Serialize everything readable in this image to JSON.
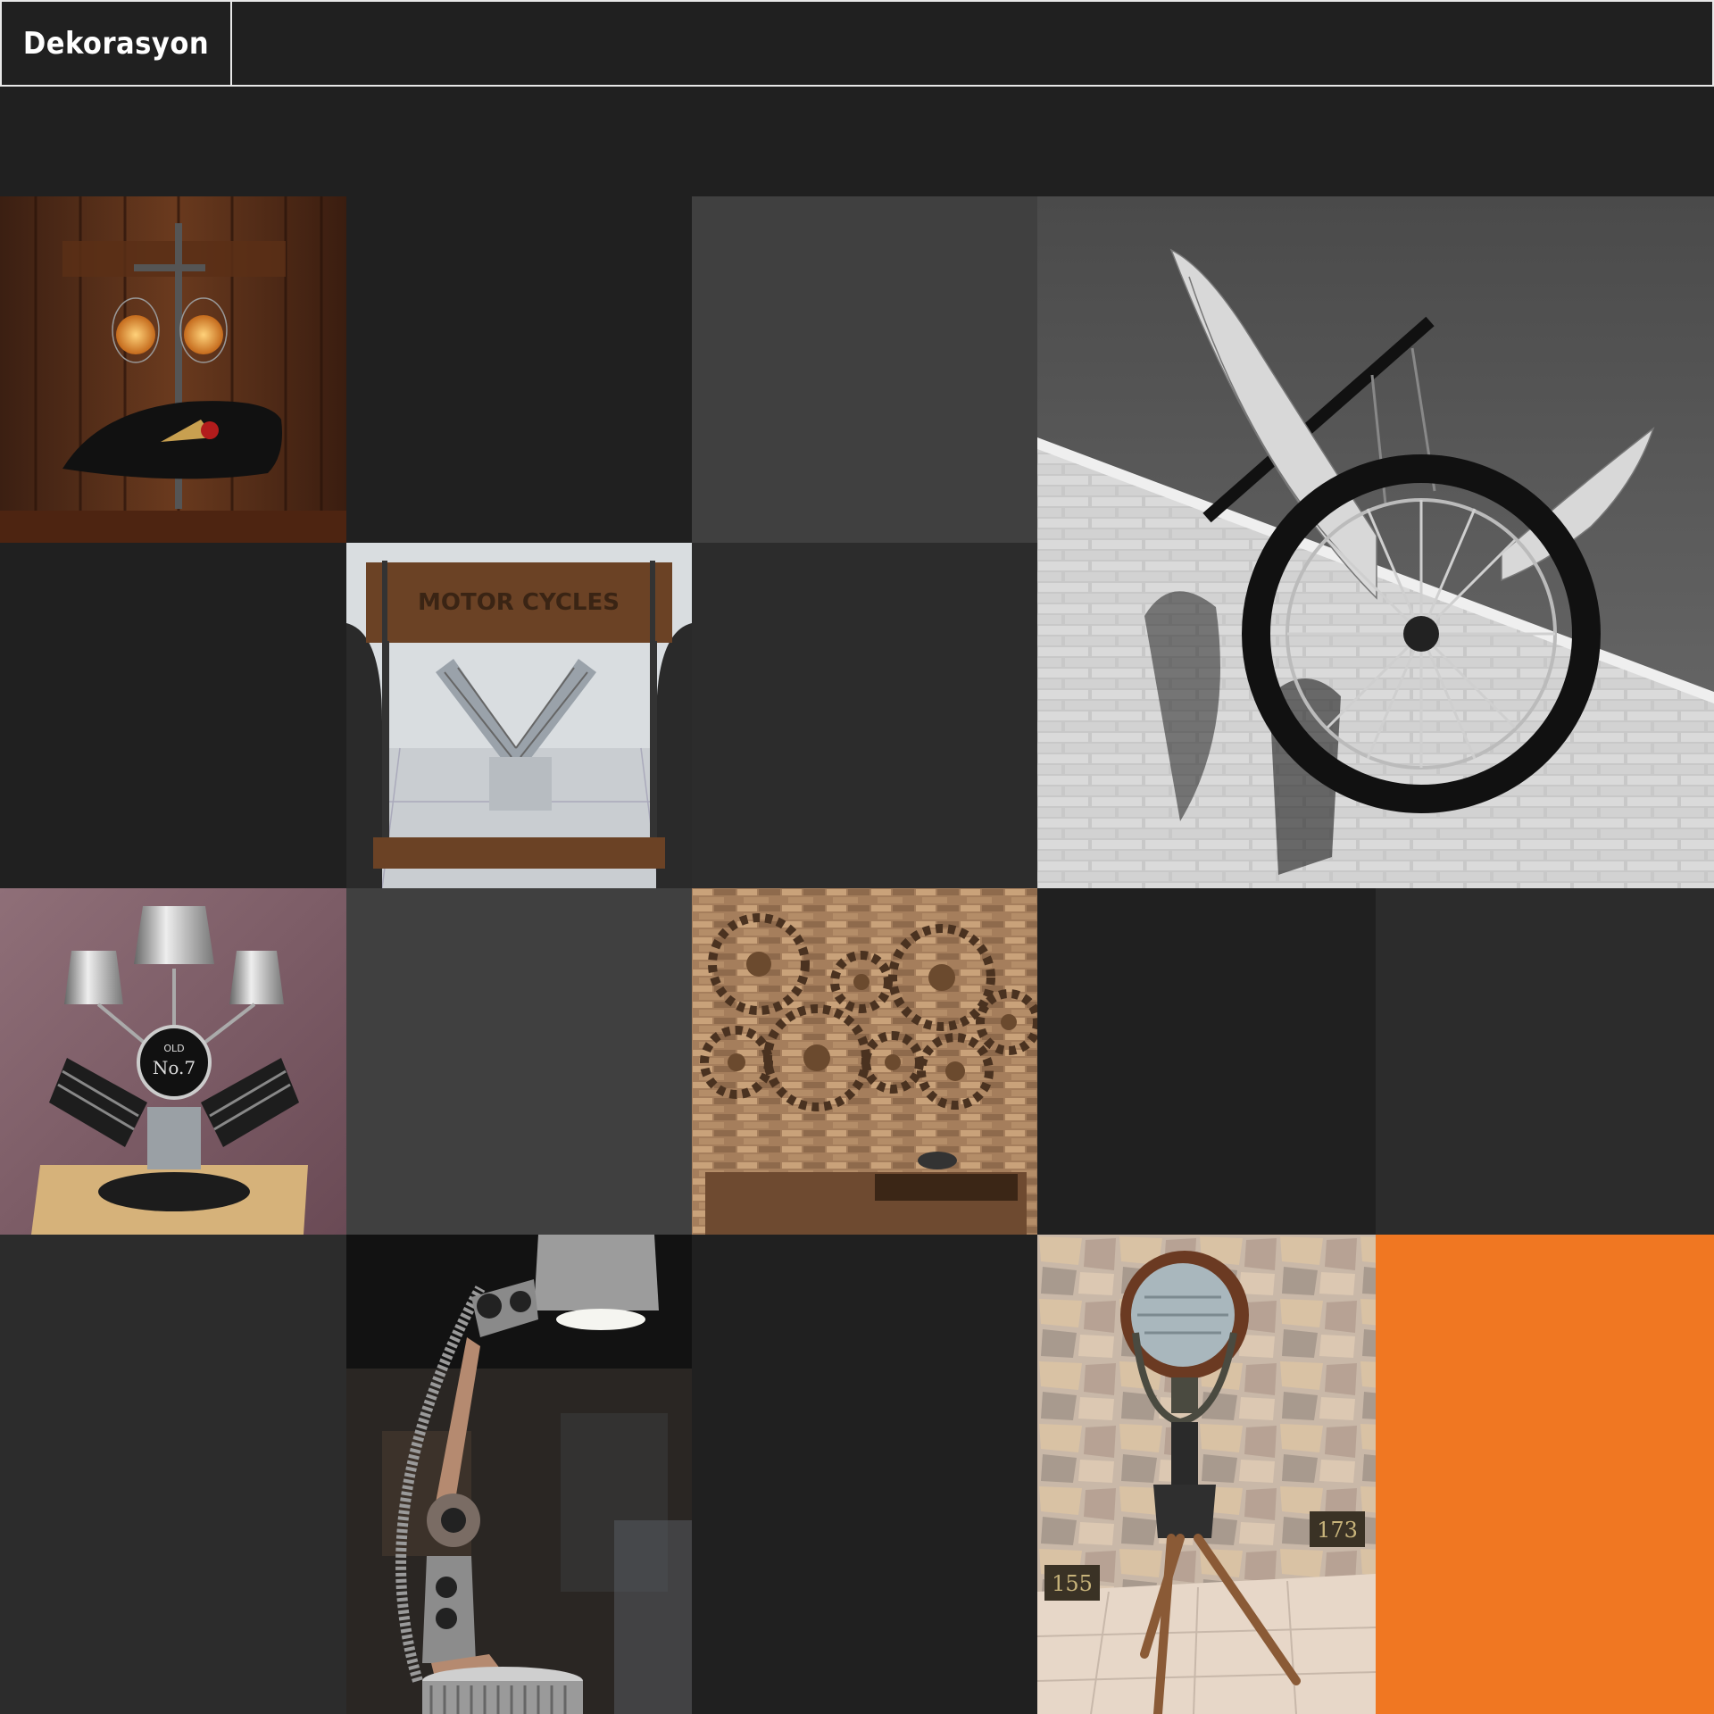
{
  "header": {
    "brand_label": "Dekorasyon"
  },
  "colors": {
    "background": "#202020",
    "tile_dark": "#202020",
    "tile_mid": "#2c2c2c",
    "tile_gray": "#404040",
    "accent_orange": "#f07722",
    "border": "#e8e8e8"
  },
  "gallery": {
    "tiles": [
      {
        "id": "fuel-tank-lamp",
        "kind": "photo",
        "subject": "lamp with pipe fittings and motorcycle fuel tank"
      },
      {
        "id": "blank-1",
        "kind": "empty"
      },
      {
        "id": "blank-2",
        "kind": "empty"
      },
      {
        "id": "winged-wheel",
        "kind": "photo",
        "subject": "winged motorcycle wheel sign on brick wall"
      },
      {
        "id": "blank-3",
        "kind": "empty"
      },
      {
        "id": "engine-table",
        "kind": "photo",
        "subject": "v-twin engine side table"
      },
      {
        "id": "blank-4",
        "kind": "empty"
      },
      {
        "id": "engine-lamp",
        "kind": "photo",
        "subject": "v-twin engine lamp"
      },
      {
        "id": "blank-5",
        "kind": "empty"
      },
      {
        "id": "gear-wall",
        "kind": "photo",
        "subject": "gear wall decor on stone wall"
      },
      {
        "id": "blank-6",
        "kind": "empty"
      },
      {
        "id": "blank-7",
        "kind": "empty"
      },
      {
        "id": "blank-8",
        "kind": "empty"
      },
      {
        "id": "piston-lamp",
        "kind": "photo",
        "subject": "piston and connecting rod desk lamp"
      },
      {
        "id": "blank-9",
        "kind": "empty"
      },
      {
        "id": "spotlight-tripod",
        "kind": "photo",
        "subject": "vintage spotlight on wooden tripod"
      },
      {
        "id": "accent-orange",
        "kind": "empty"
      }
    ],
    "photo_labels": {
      "engine_table_plaque": "MOTOR CYCLES",
      "engine_lamp_badge_old": "OLD",
      "engine_lamp_badge_no": "No.7",
      "spotlight_tag_1": "155",
      "spotlight_tag_2": "173"
    }
  }
}
